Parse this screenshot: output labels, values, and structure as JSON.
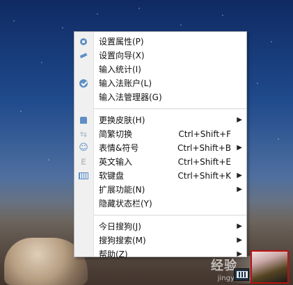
{
  "menu": {
    "items": [
      {
        "label": "设置属性(P)",
        "icon": "gear-icon",
        "shortcut": "",
        "submenu": false
      },
      {
        "label": "设置向导(X)",
        "icon": "wand-icon",
        "shortcut": "",
        "submenu": false
      },
      {
        "label": "输入统计(I)",
        "icon": "",
        "shortcut": "",
        "submenu": false
      },
      {
        "label": "输入法账户(L)",
        "icon": "account-check-icon",
        "shortcut": "",
        "submenu": false
      },
      {
        "label": "输入法管理器(G)",
        "icon": "",
        "shortcut": "",
        "submenu": false
      },
      {
        "label": "更换皮肤(H)",
        "icon": "brush-icon",
        "shortcut": "",
        "submenu": true
      },
      {
        "label": "简繁切换",
        "icon": "swap-icon",
        "shortcut": "Ctrl+Shift+F",
        "submenu": false
      },
      {
        "label": "表情&符号",
        "icon": "emoji-icon",
        "shortcut": "Ctrl+Shift+B",
        "submenu": true
      },
      {
        "label": "英文输入",
        "icon": "english-e-icon",
        "shortcut": "Ctrl+Shift+E",
        "submenu": false
      },
      {
        "label": "软键盘",
        "icon": "keyboard-icon",
        "shortcut": "Ctrl+Shift+K",
        "submenu": true
      },
      {
        "label": "扩展功能(N)",
        "icon": "",
        "shortcut": "",
        "submenu": true
      },
      {
        "label": "隐藏状态栏(Y)",
        "icon": "",
        "shortcut": "",
        "submenu": false
      },
      {
        "label": "今日搜狗(J)",
        "icon": "",
        "shortcut": "",
        "submenu": true
      },
      {
        "label": "搜狗搜索(M)",
        "icon": "",
        "shortcut": "",
        "submenu": true
      },
      {
        "label": "帮助(Z)",
        "icon": "",
        "shortcut": "",
        "submenu": true
      }
    ],
    "submenu_arrow": "▶"
  },
  "watermark": {
    "text": "Bai 经验",
    "url": "jingyan.baidu.com"
  },
  "colors": {
    "menu_bg": "#ffffff",
    "gutter_bg": "#f0f0f0",
    "accent_icon": "#5f8fc3"
  }
}
